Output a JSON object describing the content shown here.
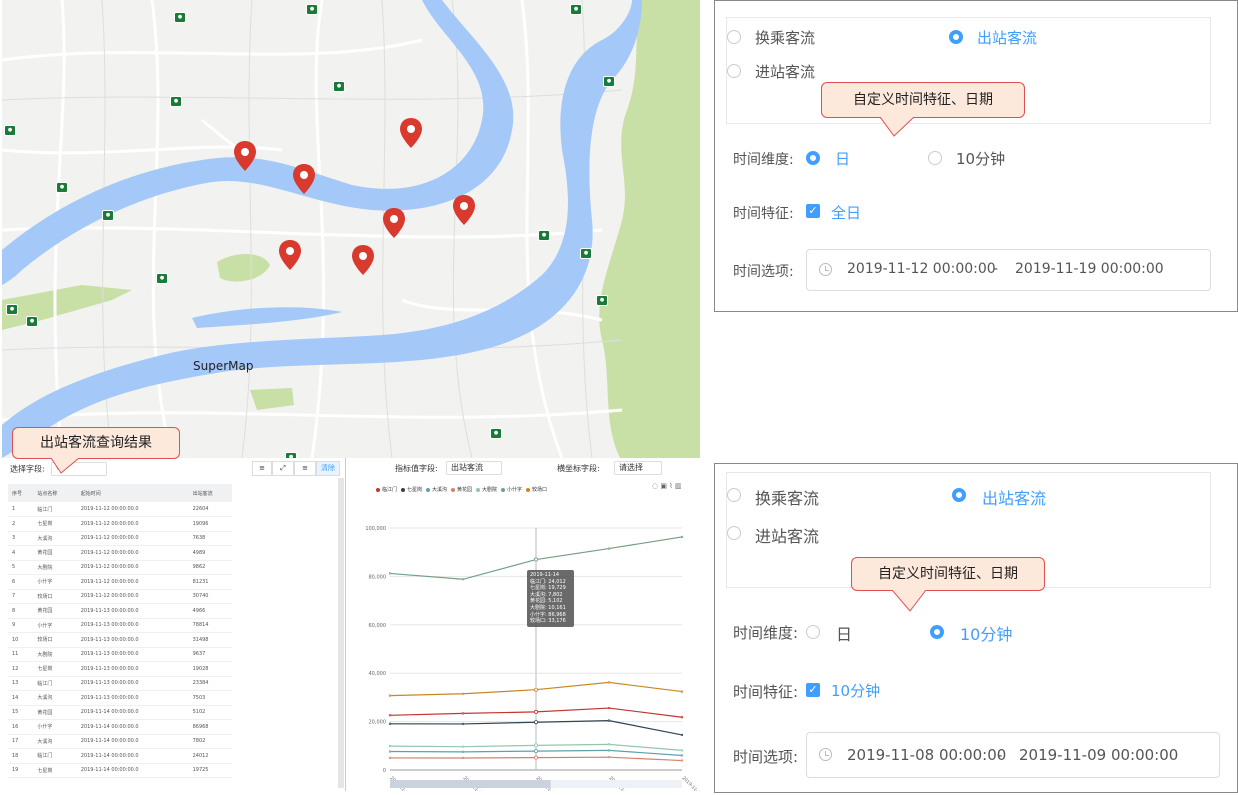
{
  "map": {
    "watermark": "SuperMap",
    "metro_icon": "metro-station-icon",
    "pin_icon": "map-pin-icon"
  },
  "callouts": {
    "query_result": "出站客流查询结果",
    "custom_time_top": "自定义时间特征、日期",
    "custom_time_bottom": "自定义时间特征、日期"
  },
  "table_panel": {
    "select_field_label": "选择字段:",
    "toolbar_buttons": [
      "≡",
      "⤢",
      "≡",
      "清除"
    ],
    "columns": [
      "序号",
      "站点名称",
      "起始时间",
      "出站客流"
    ],
    "rows": [
      [
        "1",
        "临江门",
        "2019-11-12 00:00:00.0",
        "22604"
      ],
      [
        "2",
        "七星岗",
        "2019-11-12 00:00:00.0",
        "19096"
      ],
      [
        "3",
        "大溪沟",
        "2019-11-12 00:00:00.0",
        "7638"
      ],
      [
        "4",
        "黄花园",
        "2019-11-12 00:00:00.0",
        "4989"
      ],
      [
        "5",
        "大剧院",
        "2019-11-12 00:00:00.0",
        "9862"
      ],
      [
        "6",
        "小什字",
        "2019-11-12 00:00:00.0",
        "81231"
      ],
      [
        "7",
        "较场口",
        "2019-11-12 00:00:00.0",
        "30740"
      ],
      [
        "8",
        "黄花园",
        "2019-11-13 00:00:00.0",
        "4966"
      ],
      [
        "9",
        "小什字",
        "2019-11-13 00:00:00.0",
        "78814"
      ],
      [
        "10",
        "较场口",
        "2019-11-13 00:00:00.0",
        "31498"
      ],
      [
        "11",
        "大剧院",
        "2019-11-13 00:00:00.0",
        "9637"
      ],
      [
        "12",
        "七星岗",
        "2019-11-13 00:00:00.0",
        "19028"
      ],
      [
        "13",
        "临江门",
        "2019-11-13 00:00:00.0",
        "23384"
      ],
      [
        "14",
        "大溪沟",
        "2019-11-13 00:00:00.0",
        "7503"
      ],
      [
        "15",
        "黄花园",
        "2019-11-14 00:00:00.0",
        "5102"
      ],
      [
        "16",
        "小什字",
        "2019-11-14 00:00:00.0",
        "86968"
      ],
      [
        "17",
        "大溪沟",
        "2019-11-14 00:00:00.0",
        "7802"
      ],
      [
        "18",
        "临江门",
        "2019-11-14 00:00:00.0",
        "24012"
      ],
      [
        "19",
        "七星岗",
        "2019-11-14 00:00:00.0",
        "19725"
      ]
    ]
  },
  "chart_panel": {
    "indicator_label": "指标值字段:",
    "indicator_value": "出站客流",
    "xaxis_label": "横坐标字段:",
    "xaxis_value": "请选择",
    "toolbar_icons": [
      "restore-icon",
      "save-image-icon",
      "line-chart-icon",
      "bar-chart-icon"
    ],
    "tooltip": {
      "date": "2019-11-14",
      "lines": [
        "临江门: 24,012",
        "七星岗: 19,729",
        "大溪沟: 7,802",
        "黄花园: 5,102",
        "大剧院: 10,161",
        "小什字: 86,968",
        "较场口: 33,176"
      ]
    }
  },
  "chart_data": {
    "type": "line",
    "title": "",
    "xlabel": "",
    "ylabel": "",
    "x": [
      "2019-11-12",
      "2019-11-13",
      "2019-11-14",
      "2019-11-15",
      "2019-11-16"
    ],
    "ylim": [
      0,
      100000
    ],
    "yticks": [
      "0",
      "20,000",
      "40,000",
      "60,000",
      "80,000",
      "100,000"
    ],
    "grid": true,
    "legend_position": "top-left",
    "series": [
      {
        "name": "临江门",
        "color": "#c23531",
        "values": [
          22604,
          23384,
          24012,
          25600,
          21800
        ]
      },
      {
        "name": "七星岗",
        "color": "#2f4554",
        "values": [
          19096,
          19028,
          19729,
          20400,
          14500
        ]
      },
      {
        "name": "大溪沟",
        "color": "#61a0a8",
        "values": [
          7638,
          7503,
          7802,
          8100,
          6000
        ]
      },
      {
        "name": "黄花园",
        "color": "#d48265",
        "values": [
          4989,
          4966,
          5102,
          5300,
          3900
        ]
      },
      {
        "name": "大剧院",
        "color": "#91c7ae",
        "values": [
          9862,
          9637,
          10161,
          10600,
          8100
        ]
      },
      {
        "name": "小什字",
        "color": "#749f83",
        "values": [
          81231,
          78814,
          86968,
          91500,
          96300
        ]
      },
      {
        "name": "较场口",
        "color": "#ca8622",
        "values": [
          30740,
          31498,
          33176,
          36200,
          32400
        ]
      }
    ]
  },
  "panel_top": {
    "options": [
      "换乘客流",
      "出站客流",
      "进站客流"
    ],
    "selected_option": "出站客流",
    "time_dim_label": "时间维度:",
    "time_dim_options": [
      "日",
      "10分钟"
    ],
    "time_dim_selected": "日",
    "time_feature_label": "时间特征:",
    "time_feature_value": "全日",
    "time_option_label": "时间选项:",
    "date_start": "2019-11-12 00:00:00",
    "date_sep": "-",
    "date_end": "2019-11-19 00:00:00"
  },
  "panel_bottom": {
    "options": [
      "换乘客流",
      "出站客流",
      "进站客流"
    ],
    "selected_option": "出站客流",
    "time_dim_label": "时间维度:",
    "time_dim_options": [
      "日",
      "10分钟"
    ],
    "time_dim_selected": "10分钟",
    "time_feature_label": "时间特征:",
    "time_feature_value": "10分钟",
    "time_option_label": "时间选项:",
    "date_start": "2019-11-08 00:00:00",
    "date_sep": "-",
    "date_end": "2019-11-09 00:00:00"
  },
  "colors": {
    "accent": "#409eff",
    "river": "#a4c8f8",
    "park": "#c8e0a6",
    "callout_bg": "#fde8dc",
    "callout_border": "#e05050"
  }
}
